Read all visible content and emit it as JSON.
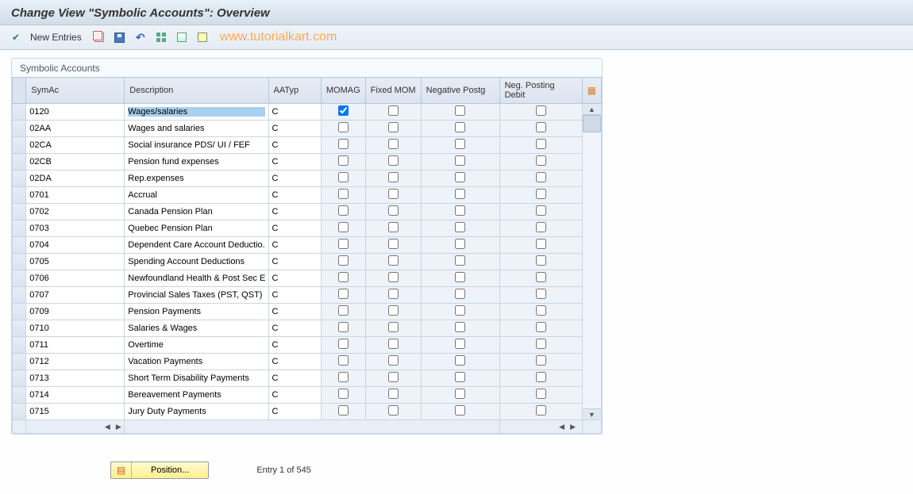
{
  "title": "Change View \"Symbolic Accounts\": Overview",
  "toolbar": {
    "new_entries": "New Entries"
  },
  "watermark": "www.tutorialkart.com",
  "group_title": "Symbolic Accounts",
  "columns": {
    "symac": "SymAc",
    "desc": "Description",
    "aatyp": "AATyp",
    "momag": "MOMAG",
    "fixed": "Fixed MOM",
    "neg": "Negative Postg",
    "negdebit": "Neg. Posting Debit"
  },
  "rows": [
    {
      "symac": "0120",
      "desc": "Wages/salaries",
      "aatyp": "C",
      "momag": true,
      "fixed": false,
      "neg": false,
      "negdebit": false,
      "selected": true
    },
    {
      "symac": "02AA",
      "desc": "Wages and salaries",
      "aatyp": "C",
      "momag": false,
      "fixed": false,
      "neg": false,
      "negdebit": false
    },
    {
      "symac": "02CA",
      "desc": "Social insurance PDS/ UI / FEF",
      "aatyp": "C",
      "momag": false,
      "fixed": false,
      "neg": false,
      "negdebit": false
    },
    {
      "symac": "02CB",
      "desc": "Pension fund expenses",
      "aatyp": "C",
      "momag": false,
      "fixed": false,
      "neg": false,
      "negdebit": false
    },
    {
      "symac": "02DA",
      "desc": "Rep.expenses",
      "aatyp": "C",
      "momag": false,
      "fixed": false,
      "neg": false,
      "negdebit": false
    },
    {
      "symac": "0701",
      "desc": "Accrual",
      "aatyp": "C",
      "momag": false,
      "fixed": false,
      "neg": false,
      "negdebit": false
    },
    {
      "symac": "0702",
      "desc": "Canada Pension Plan",
      "aatyp": "C",
      "momag": false,
      "fixed": false,
      "neg": false,
      "negdebit": false
    },
    {
      "symac": "0703",
      "desc": "Quebec Pension Plan",
      "aatyp": "C",
      "momag": false,
      "fixed": false,
      "neg": false,
      "negdebit": false
    },
    {
      "symac": "0704",
      "desc": "Dependent Care Account Deductio..",
      "aatyp": "C",
      "momag": false,
      "fixed": false,
      "neg": false,
      "negdebit": false
    },
    {
      "symac": "0705",
      "desc": "Spending Account Deductions",
      "aatyp": "C",
      "momag": false,
      "fixed": false,
      "neg": false,
      "negdebit": false
    },
    {
      "symac": "0706",
      "desc": "Newfoundland Health & Post Sec E..",
      "aatyp": "C",
      "momag": false,
      "fixed": false,
      "neg": false,
      "negdebit": false
    },
    {
      "symac": "0707",
      "desc": "Provincial Sales Taxes (PST, QST)",
      "aatyp": "C",
      "momag": false,
      "fixed": false,
      "neg": false,
      "negdebit": false
    },
    {
      "symac": "0709",
      "desc": "Pension Payments",
      "aatyp": "C",
      "momag": false,
      "fixed": false,
      "neg": false,
      "negdebit": false
    },
    {
      "symac": "0710",
      "desc": "Salaries & Wages",
      "aatyp": "C",
      "momag": false,
      "fixed": false,
      "neg": false,
      "negdebit": false
    },
    {
      "symac": "0711",
      "desc": "Overtime",
      "aatyp": "C",
      "momag": false,
      "fixed": false,
      "neg": false,
      "negdebit": false
    },
    {
      "symac": "0712",
      "desc": "Vacation Payments",
      "aatyp": "C",
      "momag": false,
      "fixed": false,
      "neg": false,
      "negdebit": false
    },
    {
      "symac": "0713",
      "desc": "Short Term Disability Payments",
      "aatyp": "C",
      "momag": false,
      "fixed": false,
      "neg": false,
      "negdebit": false
    },
    {
      "symac": "0714",
      "desc": "Bereavement Payments",
      "aatyp": "C",
      "momag": false,
      "fixed": false,
      "neg": false,
      "negdebit": false
    },
    {
      "symac": "0715",
      "desc": "Jury Duty Payments",
      "aatyp": "C",
      "momag": false,
      "fixed": false,
      "neg": false,
      "negdebit": false
    }
  ],
  "footer": {
    "position_btn": "Position...",
    "entry_text": "Entry 1 of 545"
  }
}
